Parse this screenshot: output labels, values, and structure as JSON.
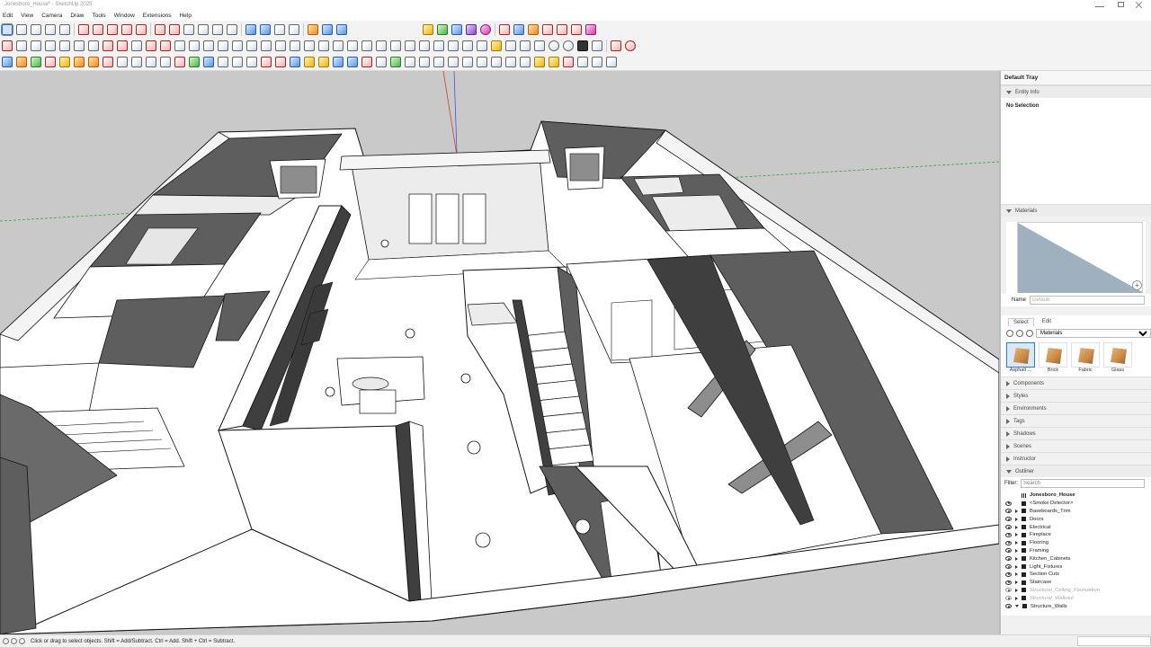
{
  "window": {
    "title": "Jonesboro_House* - SketchUp 2025"
  },
  "menu": [
    "Edit",
    "View",
    "Camera",
    "Draw",
    "Tools",
    "Window",
    "Extensions",
    "Help"
  ],
  "toolbar_icons": {
    "row1": [
      "select-tool",
      "eraser-tool",
      "pencil-tool",
      "line-tool",
      "rectangle-tool",
      "push-pull-tool",
      "move-tool",
      "rotate-tool",
      "scale-tool",
      "orbit-tool",
      "pan-tool",
      "zoom-tool",
      "zoom-extents-tool",
      "warehouse",
      "extension-warehouse",
      "layout",
      "profile",
      "solid-tools",
      "extension-orange",
      "extension-purple",
      "extension-red"
    ],
    "row2": [
      "select-arrow",
      "eraser",
      "paint",
      "move",
      "rotate",
      "scale",
      "push-pull",
      "follow-me",
      "offset",
      "tape-measure",
      "dimension",
      "protractor",
      "text",
      "axes",
      "3d-text",
      "section-plane",
      "position-camera",
      "walk",
      "look-around",
      "zoom-window",
      "previous-view",
      "next-view"
    ],
    "row3": [
      "sandbox-diamond",
      "sandbox-smoove",
      "sandbox-stamp",
      "sandbox-drape",
      "sandbox-add-detail",
      "sandbox-flip-edge",
      "arc",
      "circle",
      "polygon",
      "freehand",
      "2-point-arc",
      "pie",
      "intersect",
      "outer-shell",
      "union",
      "subtract",
      "trim",
      "split",
      "settings"
    ]
  },
  "tray": {
    "title": "Default Tray",
    "entity_info": {
      "header": "Entity Info",
      "selection": "No Selection"
    },
    "materials": {
      "header": "Materials",
      "name_label": "Name",
      "name_value": "Default",
      "tabs": [
        "Select",
        "Edit"
      ],
      "library": "Materials",
      "thumbnails": [
        "Asphalt ...",
        "Brick",
        "Fabric",
        "Glass"
      ],
      "swatch_color": "#9fb1bf"
    },
    "panels": [
      "Components",
      "Styles",
      "Environments",
      "Tags",
      "Shadows",
      "Scenes",
      "Instructor"
    ],
    "outliner": {
      "header": "Outliner",
      "filter_label": "Filter:",
      "filter_placeholder": "Search",
      "root": "Jonesboro_House",
      "items": [
        {
          "label": "<Smoke Detector>",
          "visible": true,
          "expand": "none",
          "dim": false
        },
        {
          "label": "Baseboards_Trim",
          "visible": true,
          "expand": "right",
          "dim": false
        },
        {
          "label": "Doors",
          "visible": true,
          "expand": "right",
          "dim": false
        },
        {
          "label": "Electrical",
          "visible": true,
          "expand": "right",
          "dim": false
        },
        {
          "label": "Fireplace",
          "visible": true,
          "expand": "right",
          "dim": false
        },
        {
          "label": "Flooring",
          "visible": true,
          "expand": "right",
          "dim": false
        },
        {
          "label": "Framing",
          "visible": true,
          "expand": "right",
          "dim": false
        },
        {
          "label": "Kitchen_Cabinets",
          "visible": true,
          "expand": "right",
          "dim": false
        },
        {
          "label": "Light_Fixtures",
          "visible": true,
          "expand": "right",
          "dim": false
        },
        {
          "label": "Section Cuts",
          "visible": true,
          "expand": "right",
          "dim": false
        },
        {
          "label": "Staircase",
          "visible": true,
          "expand": "right",
          "dim": false
        },
        {
          "label": "Structural_Ceiling_Foundation",
          "visible": false,
          "expand": "right",
          "dim": true
        },
        {
          "label": "Structural_Walkout",
          "visible": false,
          "expand": "right",
          "dim": true
        },
        {
          "label": "Structure_Walls",
          "visible": true,
          "expand": "down",
          "dim": false
        }
      ]
    }
  },
  "status": {
    "hint": "Click or drag to select objects. Shift = Add/Subtract. Ctrl = Add. Shift + Ctrl = Subtract."
  },
  "colors": {
    "viewport_bg": "#c9c9c9",
    "wall_dark": "#5e5e5e",
    "wall_mid": "#8d8d8d",
    "floor": "#ffffff",
    "axis_red": "#d23a3a",
    "axis_green": "#3aa03a",
    "axis_blue": "#3a5bd2"
  }
}
